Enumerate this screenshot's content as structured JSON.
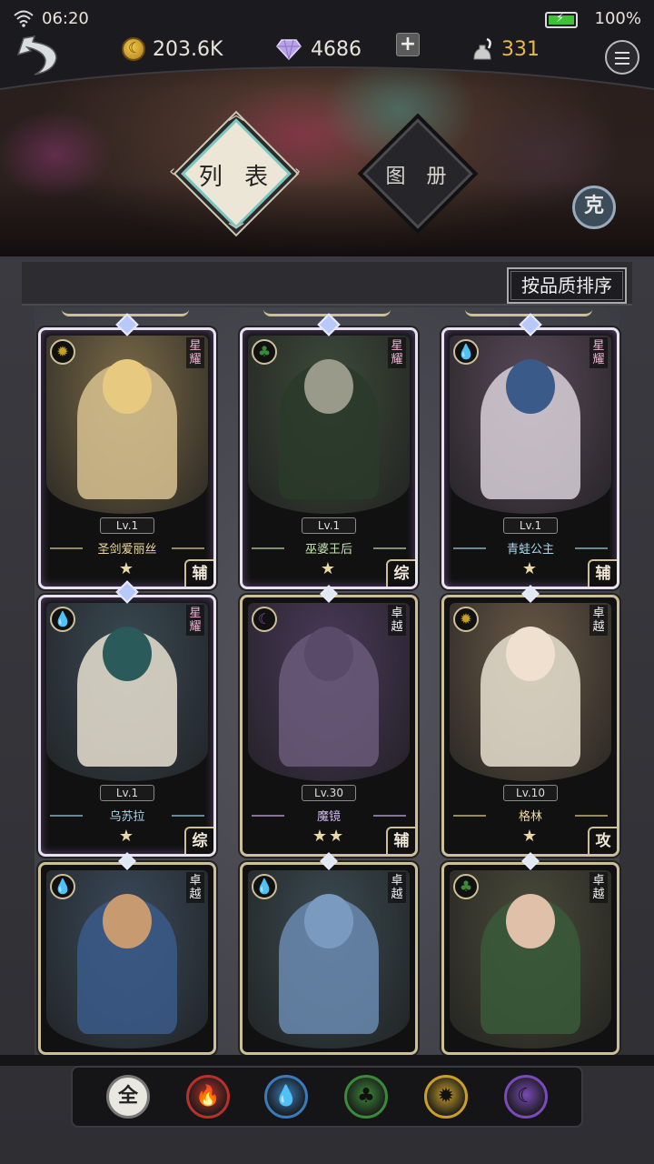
{
  "status_bar": {
    "time": "06:20",
    "battery": "100%"
  },
  "resources": {
    "gold": "203.6K",
    "diamonds": "4686",
    "ink": "331"
  },
  "tabs": {
    "list": "列 表",
    "album": "图 册"
  },
  "ke_button": "克",
  "sort_button": "按品质排序",
  "cards": [
    {
      "rank": "星耀",
      "rank_type": "star",
      "element": "light",
      "level": "Lv.1",
      "name": "圣剑爱丽丝",
      "name_color": "gold",
      "stars": "★",
      "role": "辅",
      "art_bg": "#7a6a48",
      "fig_color": "#d8c290",
      "head_color": "#e8c980"
    },
    {
      "rank": "星耀",
      "rank_type": "star",
      "element": "nature",
      "level": "Lv.1",
      "name": "巫婆王后",
      "name_color": "green",
      "stars": "★",
      "role": "综",
      "art_bg": "#3e4a3a",
      "fig_color": "#2a3a2a",
      "head_color": "#9a9a8a"
    },
    {
      "rank": "星耀",
      "rank_type": "star",
      "element": "water",
      "level": "Lv.1",
      "name": "青蛙公主",
      "name_color": "blue",
      "stars": "★",
      "role": "辅",
      "art_bg": "#5a4a5a",
      "fig_color": "#d8d0d8",
      "head_color": "#3a5a8a"
    },
    {
      "rank": "星耀",
      "rank_type": "star",
      "element": "water",
      "level": "Lv.1",
      "name": "乌苏拉",
      "name_color": "blue",
      "stars": "★",
      "role": "综",
      "art_bg": "#3a4a54",
      "fig_color": "#e8e0d0",
      "head_color": "#2a5a5a"
    },
    {
      "rank": "卓越",
      "rank_type": "gold",
      "element": "dark",
      "level": "Lv.30",
      "name": "魔镜",
      "name_color": "purple",
      "stars": "★★",
      "role": "辅",
      "art_bg": "#4a3a5a",
      "fig_color": "#6a5a7a",
      "head_color": "#5a4a6a"
    },
    {
      "rank": "卓越",
      "rank_type": "gold",
      "element": "light",
      "level": "Lv.10",
      "name": "格林",
      "name_color": "gold",
      "stars": "★",
      "role": "攻",
      "art_bg": "#6a5a48",
      "fig_color": "#e8e0d0",
      "head_color": "#f0e0d0"
    },
    {
      "rank": "卓越",
      "rank_type": "gold",
      "element": "water",
      "art_bg": "#3a4a5a",
      "fig_color": "#3a5a8a",
      "head_color": "#c89a70"
    },
    {
      "rank": "卓越",
      "rank_type": "gold",
      "element": "water",
      "art_bg": "#3a4a50",
      "fig_color": "#6a8ab0",
      "head_color": "#7a9ac0"
    },
    {
      "rank": "卓越",
      "rank_type": "gold",
      "element": "nature",
      "art_bg": "#4a4a3a",
      "fig_color": "#3a5a3a",
      "head_color": "#e0c0a8"
    }
  ],
  "filters": [
    {
      "name": "all",
      "label": "全"
    },
    {
      "name": "fire",
      "label": ""
    },
    {
      "name": "water",
      "label": ""
    },
    {
      "name": "nature",
      "label": ""
    },
    {
      "name": "light",
      "label": ""
    },
    {
      "name": "dark",
      "label": ""
    }
  ],
  "colors": {
    "accent_teal": "#7ac6c0",
    "fire": "#b8302a",
    "water": "#3a7ab8",
    "nature": "#3a8a3a",
    "light": "#c8a028",
    "dark": "#7a4ab8"
  }
}
